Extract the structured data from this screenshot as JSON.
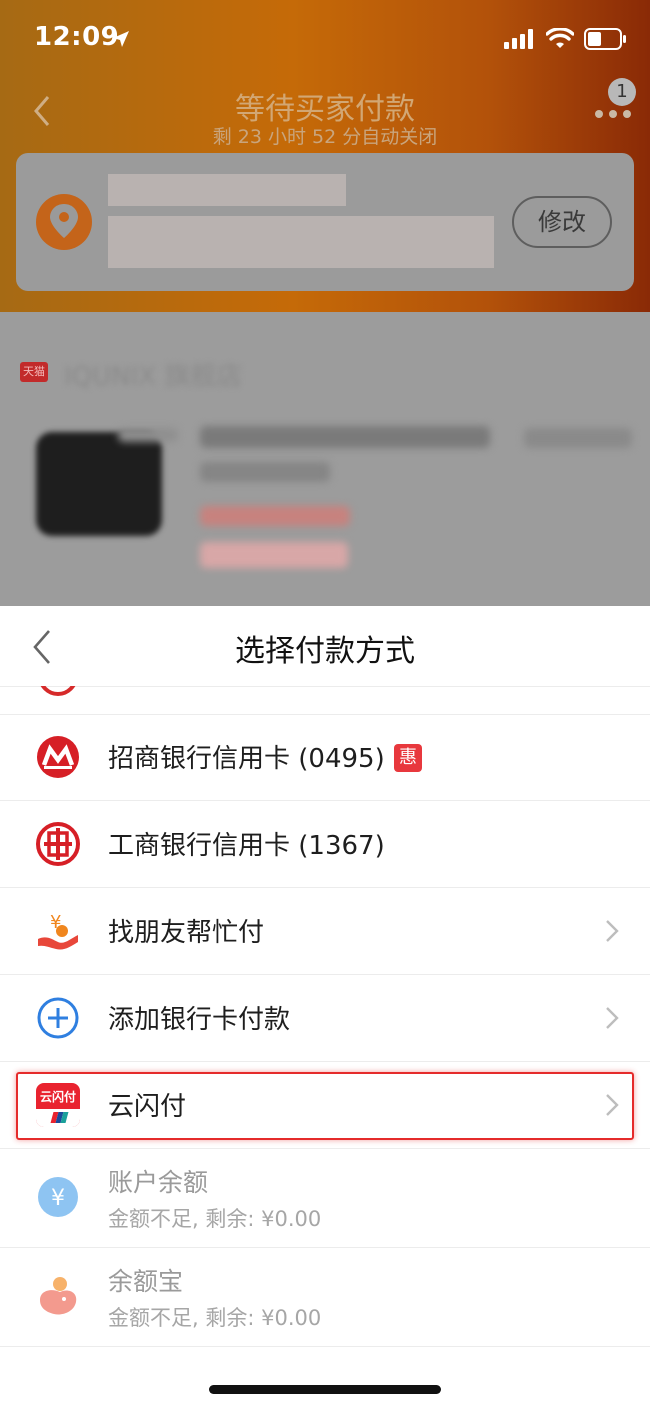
{
  "status_bar": {
    "time": "12:09"
  },
  "order_page": {
    "title": "等待买家付款",
    "subtitle": "剩 23 小时 52 分自动关闭",
    "notification_count": "1",
    "address_edit_label": "修改",
    "store_tag": "天猫",
    "store_name": "IQUNIX 旗舰店"
  },
  "payment_sheet": {
    "title": "选择付款方式",
    "methods": [
      {
        "label": "招商银行信用卡 (0495)",
        "icon": "cmb-bank-icon",
        "promo_badge": "惠"
      },
      {
        "label": "工商银行信用卡 (1367)",
        "icon": "icbc-bank-icon"
      },
      {
        "label": "找朋友帮忙付",
        "icon": "friend-pay-icon"
      },
      {
        "label": "添加银行卡付款",
        "icon": "add-card-icon"
      },
      {
        "label": "云闪付",
        "icon": "unionpay-quickpass-icon",
        "icon_text": "云闪付",
        "highlighted": true
      }
    ],
    "disabled_methods": [
      {
        "label": "账户余额",
        "sub": "金额不足, 剩余: ¥0.00",
        "icon": "balance-yuan-icon"
      },
      {
        "label": "余额宝",
        "sub": "金额不足, 剩余: ¥0.00",
        "icon": "yuebao-icon"
      }
    ]
  },
  "colors": {
    "header_gradient_start": "#a66a14",
    "header_gradient_end": "#8a2a06",
    "highlight_border": "#e52b2b",
    "promo_badge": "#e8383d",
    "add_card_blue": "#2f7fe0",
    "balance_blue": "#8ec4f2"
  }
}
